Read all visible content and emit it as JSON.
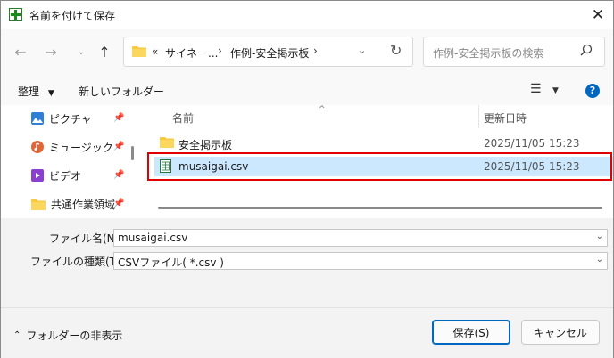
{
  "window": {
    "title": "名前を付けて保存"
  },
  "nav": {
    "crumbs": [
      "«",
      "サイネー...",
      "作例-安全掲示板"
    ],
    "search_placeholder": "作例-安全掲示板の検索"
  },
  "toolbar": {
    "organize": "整理",
    "new_folder": "新しいフォルダー",
    "help": "?"
  },
  "sidebar": {
    "items": [
      {
        "label": "ピクチャ",
        "icon": "pictures-icon"
      },
      {
        "label": "ミュージック",
        "icon": "music-icon"
      },
      {
        "label": "ビデオ",
        "icon": "video-icon"
      },
      {
        "label": "共通作業領域"
      }
    ]
  },
  "filelist": {
    "columns": {
      "name": "名前",
      "modified": "更新日時"
    },
    "rows": [
      {
        "name": "安全掲示板",
        "date": "2025/11/05 15:23",
        "type": "folder"
      },
      {
        "name": "musaigai.csv",
        "date": "2025/11/05 15:23",
        "type": "csv",
        "selected": true
      }
    ]
  },
  "form": {
    "filename_label": "ファイル名(N):",
    "filename_value": "musaigai.csv",
    "filetype_label": "ファイルの種類(T):",
    "filetype_value": "CSVファイル( *.csv )"
  },
  "footer": {
    "hide_folders": "フォルダーの非表示",
    "save": "保存(S)",
    "cancel": "キャンセル"
  },
  "colors": {
    "accent": "#0067c0",
    "selection": "#cce8ff",
    "highlight_box": "#e00000"
  }
}
